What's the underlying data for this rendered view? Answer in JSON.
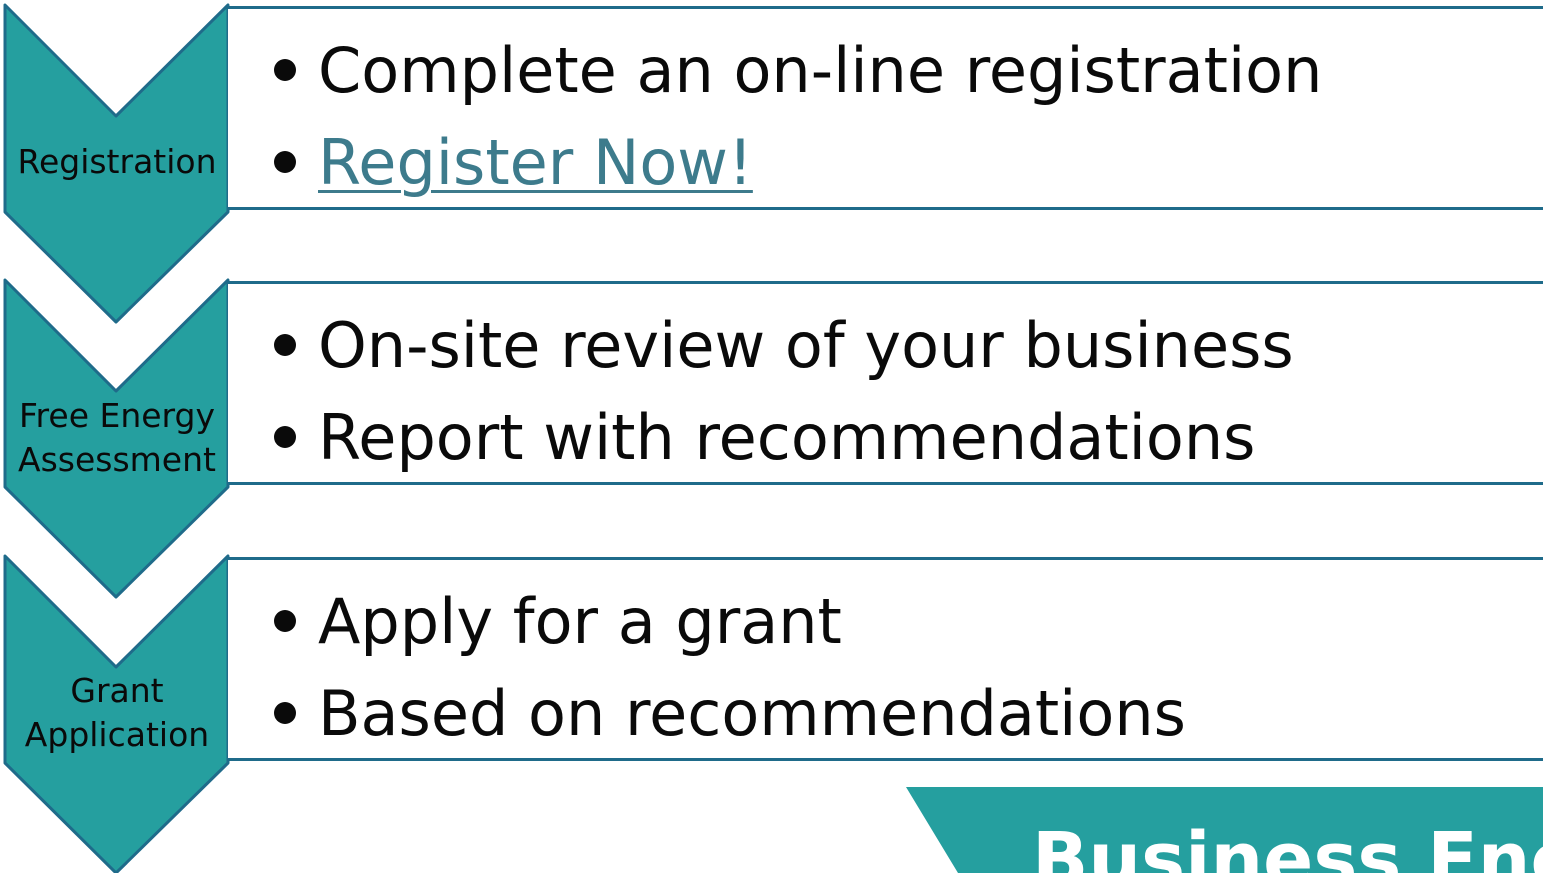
{
  "colors": {
    "chevron_fill": "#259f9f",
    "chevron_stroke": "#1f6b8a",
    "box_border": "#1f6b8a",
    "link": "#3d7b8c",
    "banner": "#259f9f"
  },
  "steps": [
    {
      "label_lines": [
        "Registration"
      ],
      "bullets": [
        {
          "text": "Complete an on-line registration",
          "link": false
        },
        {
          "text": "Register Now!",
          "link": true
        }
      ]
    },
    {
      "label_lines": [
        "Free Energy",
        "Assessment"
      ],
      "bullets": [
        {
          "text": "On-site review of your business",
          "link": false
        },
        {
          "text": "Report with recommendations",
          "link": false
        }
      ]
    },
    {
      "label_lines": [
        "Grant",
        "Application"
      ],
      "bullets": [
        {
          "text": "Apply for a grant",
          "link": false
        },
        {
          "text": "Based on recommendations",
          "link": false
        }
      ]
    }
  ],
  "banner": {
    "text": "Business Ene"
  }
}
